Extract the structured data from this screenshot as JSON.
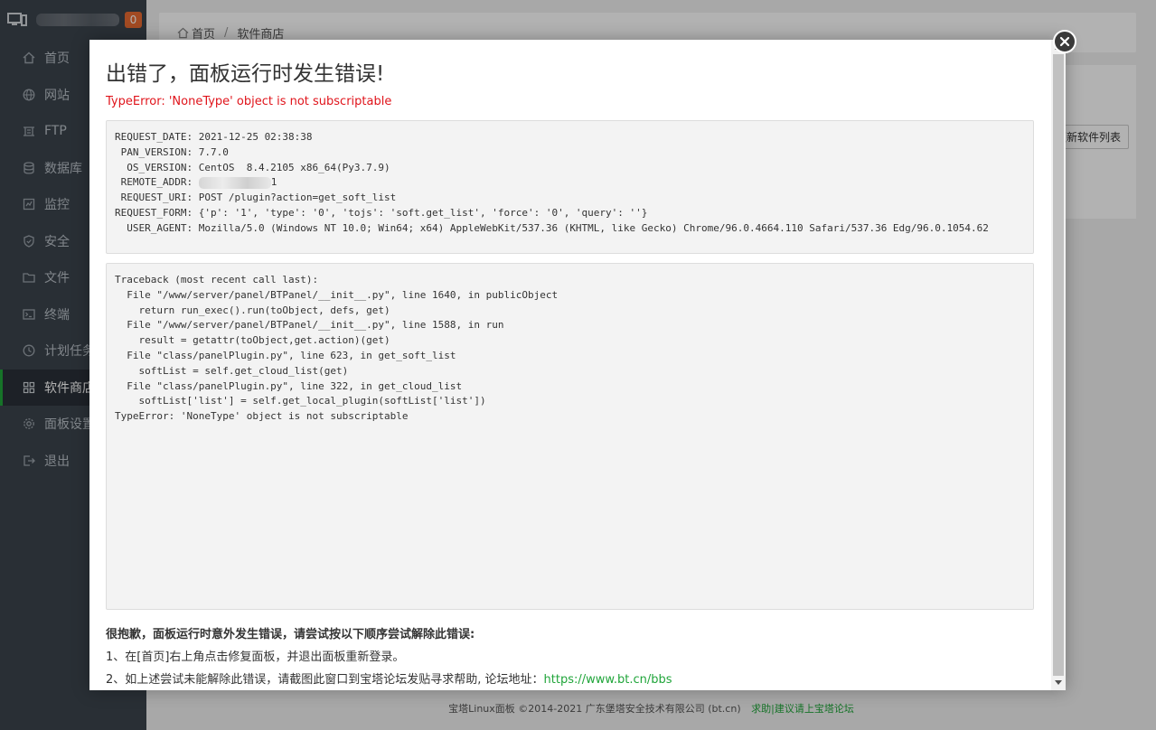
{
  "sidebar": {
    "badge": "0",
    "items": [
      {
        "label": "首页",
        "icon": "home-icon"
      },
      {
        "label": "网站",
        "icon": "globe-icon"
      },
      {
        "label": "FTP",
        "icon": "ftp-icon"
      },
      {
        "label": "数据库",
        "icon": "database-icon"
      },
      {
        "label": "监控",
        "icon": "monitor-icon"
      },
      {
        "label": "安全",
        "icon": "shield-icon"
      },
      {
        "label": "文件",
        "icon": "folder-icon"
      },
      {
        "label": "终端",
        "icon": "terminal-icon"
      },
      {
        "label": "计划任务",
        "icon": "clock-icon"
      },
      {
        "label": "软件商店",
        "icon": "grid-icon",
        "active": true
      },
      {
        "label": "面板设置",
        "icon": "gear-icon"
      },
      {
        "label": "退出",
        "icon": "logout-icon"
      }
    ]
  },
  "breadcrumb": {
    "home": "首页",
    "separator": "/",
    "current": "软件商店"
  },
  "update_button": "更新软件列表",
  "footer": {
    "copyright": "宝塔Linux面板 ©2014-2021 广东堡塔安全技术有限公司 (bt.cn)",
    "link": "求助|建议请上宝塔论坛"
  },
  "modal": {
    "title": "出错了，面板运行时发生错误!",
    "error": "TypeError: 'NoneType' object is not subscriptable",
    "request": {
      "date_line": "REQUEST_DATE: 2021-12-25 02:38:38",
      "pan_line": " PAN_VERSION: 7.7.0",
      "os_line": "  OS_VERSION: CentOS  8.4.2105 x86_64(Py3.7.9)",
      "addr_label": " REMOTE_ADDR: ",
      "addr_suffix": "1",
      "uri_line": " REQUEST_URI: POST /plugin?action=get_soft_list",
      "form_line": "REQUEST_FORM: {'p': '1', 'type': '0', 'tojs': 'soft.get_list', 'force': '0', 'query': ''}",
      "agent_line": "  USER_AGENT: Mozilla/5.0 (Windows NT 10.0; Win64; x64) AppleWebKit/537.36 (KHTML, like Gecko) Chrome/96.0.4664.110 Safari/537.36 Edg/96.0.1054.62"
    },
    "traceback": "Traceback (most recent call last):\n  File \"/www/server/panel/BTPanel/__init__.py\", line 1640, in publicObject\n    return run_exec().run(toObject, defs, get)\n  File \"/www/server/panel/BTPanel/__init__.py\", line 1588, in run\n    result = getattr(toObject,get.action)(get)\n  File \"class/panelPlugin.py\", line 623, in get_soft_list\n    softList = self.get_cloud_list(get)\n  File \"class/panelPlugin.py\", line 322, in get_cloud_list\n    softList['list'] = self.get_local_plugin(softList['list'])\nTypeError: 'NoneType' object is not subscriptable",
    "help_title": "很抱歉，面板运行时意外发生错误，请尝试按以下顺序尝试解除此错误:",
    "help_1": "1、在[首页]右上角点击修复面板，并退出面板重新登录。",
    "help_2": "2、如上述尝试未能解除此错误，请截图此窗口到宝塔论坛发贴寻求帮助, 论坛地址：",
    "help_url": "https://www.bt.cn/bbs"
  }
}
